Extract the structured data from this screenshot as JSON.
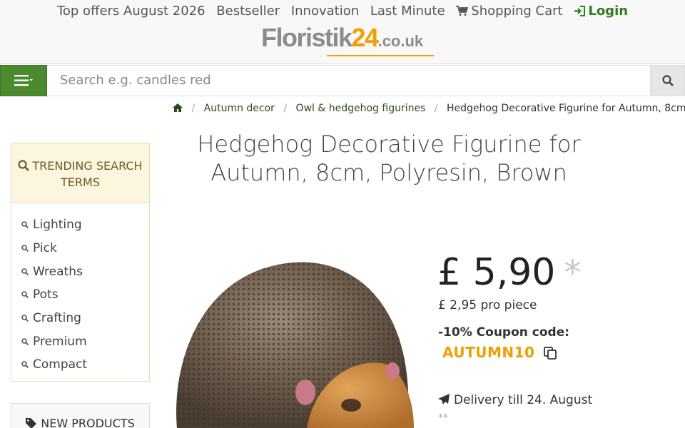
{
  "topnav": {
    "offers": "Top offers August 2026",
    "bestseller": "Bestseller",
    "innovation": "Innovation",
    "last_minute": "Last Minute",
    "cart": "Shopping Cart",
    "login": "Login"
  },
  "logo": {
    "word": "Floristik",
    "num": "24",
    "tld": ".co.uk"
  },
  "search": {
    "placeholder": "Search e.g. candles red"
  },
  "breadcrumb": {
    "items": [
      "Autumn decor",
      "Owl & hedgehog figurines",
      "Hedgehog Decorative Figurine for Autumn, 8cm,..."
    ],
    "separator": "/"
  },
  "sidebar": {
    "trending_title": "TRENDING SEARCH TERMS",
    "trending": [
      "Lighting",
      "Pick",
      "Wreaths",
      "Pots",
      "Crafting",
      "Premium",
      "Compact"
    ],
    "new_products": "NEW PRODUCTS"
  },
  "product": {
    "title": "Hedgehog Decorative Figurine for Autumn, 8cm, Polyresin, Brown",
    "price": "£ 5,90",
    "price_star": "*",
    "unit_price": "£ 2,95 pro piece",
    "coupon_label": "-10% Coupon code:",
    "coupon_code": "AUTUMN10",
    "delivery": "Delivery till 24. August",
    "footnote": "**"
  },
  "colors": {
    "brand_green": "#4b8a2e",
    "accent_orange": "#f0a000"
  }
}
